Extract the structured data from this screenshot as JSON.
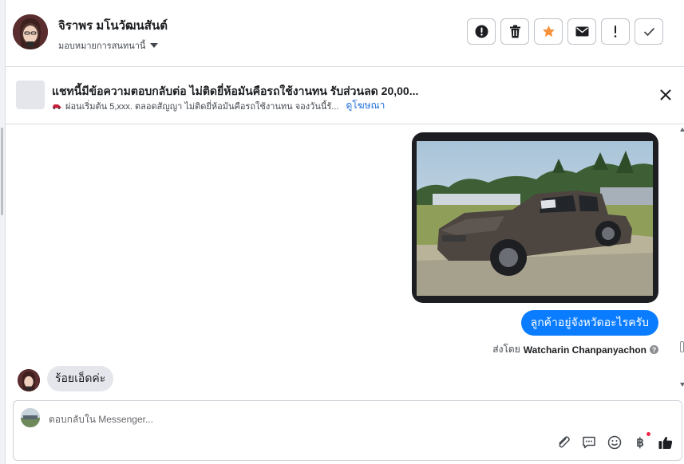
{
  "header": {
    "contact_name": "จิราพร มโนวัฒนสันต์",
    "assign_label": "มอบหมายการสนทนานี้",
    "actions": [
      {
        "name": "mark-spam-button",
        "icon": "alert-circle-icon"
      },
      {
        "name": "delete-button",
        "icon": "trash-icon"
      },
      {
        "name": "star-button",
        "icon": "star-icon"
      },
      {
        "name": "mark-unread-button",
        "icon": "envelope-icon"
      },
      {
        "name": "follow-up-button",
        "icon": "exclamation-icon"
      },
      {
        "name": "mark-done-button",
        "icon": "check-icon"
      }
    ]
  },
  "ad": {
    "title": "แชทนี้มีข้อความตอบกลับต่อ ไม่ติดยี่ห้อมันคือรถใช้งานทน รับส่วนลด 20,00...",
    "subtitle": "ผ่อนเริ่มต้น 5,xxx. ตลอดสัญญา ไม่ติดยี่ห้อมันคือรถใช้งานทน จองวันนี้รั...",
    "link": "ดูโฆษณา"
  },
  "messages": {
    "outgoing_text": "ลูกค้าอยู่จังหวัดอะไรครับ",
    "sent_by_label": "ส่งโดย",
    "sent_by_name": "Watcharin Chanpanyachon",
    "incoming_text": "ร้อยเอ็ดค่ะ"
  },
  "composer": {
    "placeholder": "ตอบกลับใน Messenger..."
  },
  "colors": {
    "accent": "#0a7cff",
    "star": "#f7923b",
    "link": "#216fdb"
  }
}
